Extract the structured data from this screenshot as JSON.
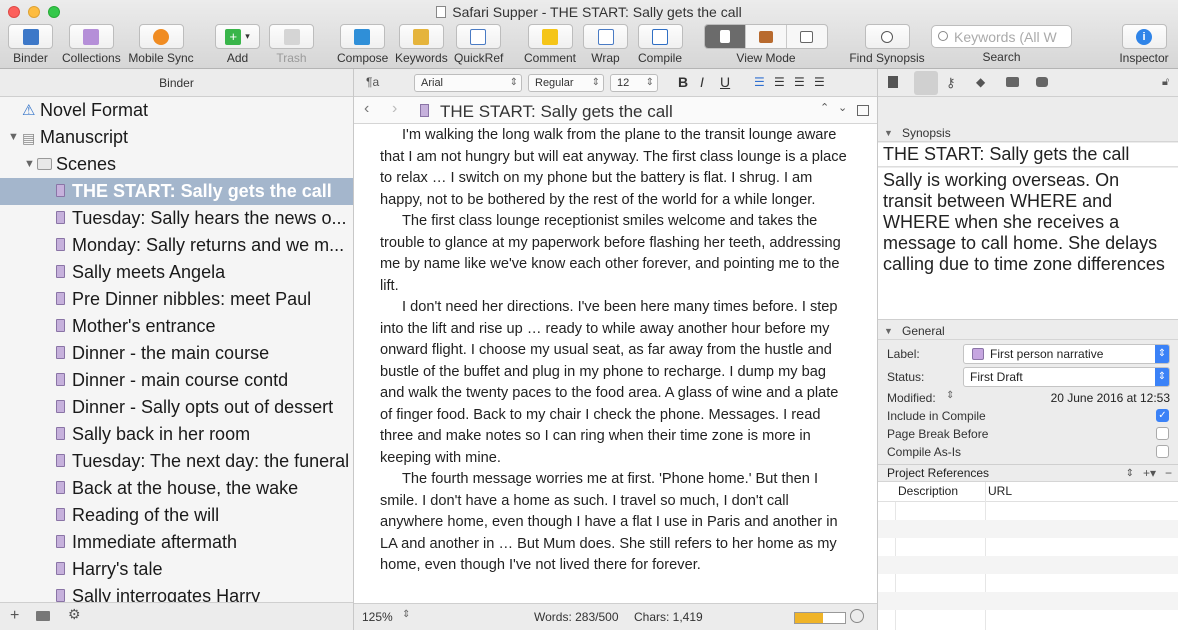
{
  "window": {
    "title": "Safari Supper - THE START: Sally gets the call"
  },
  "toolbar": {
    "binder": "Binder",
    "collections": "Collections",
    "mobile_sync": "Mobile Sync",
    "add": "Add",
    "trash": "Trash",
    "compose": "Compose",
    "keywords": "Keywords",
    "quickref": "QuickRef",
    "comment": "Comment",
    "wrap": "Wrap",
    "compile": "Compile",
    "view_mode": "View Mode",
    "find_synopsis": "Find Synopsis",
    "search_placeholder": "Keywords (All W",
    "search": "Search",
    "inspector": "Inspector"
  },
  "binder": {
    "header": "Binder",
    "items": [
      {
        "label": "Novel Format"
      },
      {
        "label": "Manuscript"
      },
      {
        "label": "Scenes"
      },
      {
        "label": "THE START: Sally gets the call"
      },
      {
        "label": "Tuesday: Sally hears the news o..."
      },
      {
        "label": "Monday: Sally returns and we m..."
      },
      {
        "label": "Sally meets Angela"
      },
      {
        "label": "Pre Dinner nibbles: meet Paul"
      },
      {
        "label": "Mother's entrance"
      },
      {
        "label": "Dinner - the main course"
      },
      {
        "label": "Dinner - main course contd"
      },
      {
        "label": "Dinner - Sally opts out of dessert"
      },
      {
        "label": "Sally back in her room"
      },
      {
        "label": "Tuesday: The next day: the funeral"
      },
      {
        "label": "Back at the house, the wake"
      },
      {
        "label": "Reading of the will"
      },
      {
        "label": "Immediate aftermath"
      },
      {
        "label": "Harry's tale"
      },
      {
        "label": "Sally interrogates Harry"
      }
    ]
  },
  "format_bar": {
    "paragraph": "¶a",
    "font": "Arial",
    "style": "Regular",
    "size": "12",
    "bold": "B",
    "italic": "I",
    "underline": "U",
    "highlight": "abc",
    "line_spacing": "1.2",
    "text_color": "#000000",
    "highlight_color": "#f7f72a"
  },
  "editor": {
    "title": "THE START: Sally gets the call",
    "paragraphs": [
      "I'm walking the long walk from the plane to the transit lounge aware that I am not hungry but will eat anyway. The first class lounge is a place to relax … I switch on my phone but the battery is flat. I shrug. I am happy, not to be bothered by the rest of the world for a while longer.",
      "The first class lounge receptionist smiles  welcome and takes the trouble to glance at my paperwork before flashing her teeth, addressing me by name like we've know each other forever, and pointing me to the lift.",
      "I don't need her directions. I've been here many times before. I step into the lift and rise up … ready to while away another hour before my onward flight. I choose my usual seat, as far away from the hustle and bustle of the buffet and plug in my phone to recharge. I dump my bag and walk the twenty paces to the food area. A glass of wine and a plate of finger food. Back to my chair I check the phone. Messages. I read three and make notes so I can ring when their time zone is more in keeping with mine.",
      "The fourth message worries me at first. 'Phone home.' But then I smile. I don't have a home as such. I travel so much, I don't call anywhere home, even though I have a flat I use in Paris and another in LA and another in … But Mum does. She still refers to her home as my home, even though I've not lived there for forever."
    ],
    "zoom": "125%",
    "words": "Words: 283/500",
    "chars": "Chars: 1,419",
    "target_progress": 0.566
  },
  "inspector": {
    "synopsis_header": "Synopsis",
    "synopsis_title": "THE START: Sally gets the call",
    "synopsis_text": "Sally is working overseas. On transit between WHERE and WHERE when she receives a message to call home. She delays calling due to time zone differences",
    "general_header": "General",
    "label_label": "Label:",
    "label_value": "First person narrative",
    "label_color": "#c6a6e0",
    "status_label": "Status:",
    "status_value": "First Draft",
    "modified_label": "Modified:",
    "modified_value": "20 June 2016 at 12:53",
    "include_compile": "Include in Compile",
    "include_compile_checked": true,
    "page_break": "Page Break Before",
    "page_break_checked": false,
    "compile_as_is": "Compile As-Is",
    "compile_as_is_checked": false,
    "refs_header": "Project References",
    "col_description": "Description",
    "col_url": "URL"
  }
}
